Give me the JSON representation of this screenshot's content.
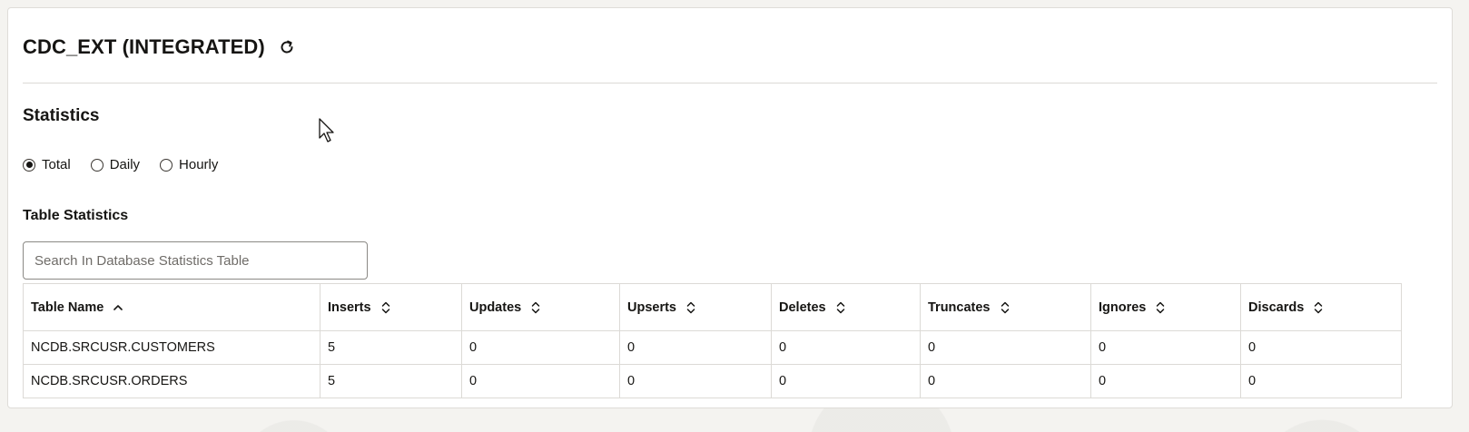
{
  "header": {
    "title": "CDC_EXT (INTEGRATED)",
    "refresh_icon": "refresh-icon"
  },
  "statistics": {
    "title": "Statistics",
    "options": [
      {
        "label": "Total",
        "selected": true
      },
      {
        "label": "Daily",
        "selected": false
      },
      {
        "label": "Hourly",
        "selected": false
      }
    ]
  },
  "table_statistics": {
    "title": "Table Statistics",
    "search": {
      "placeholder": "Search In Database Statistics Table",
      "value": ""
    },
    "columns": [
      {
        "label": "Table Name",
        "sort": "ascending"
      },
      {
        "label": "Inserts",
        "sort": "none"
      },
      {
        "label": "Updates",
        "sort": "none"
      },
      {
        "label": "Upserts",
        "sort": "none"
      },
      {
        "label": "Deletes",
        "sort": "none"
      },
      {
        "label": "Truncates",
        "sort": "none"
      },
      {
        "label": "Ignores",
        "sort": "none"
      },
      {
        "label": "Discards",
        "sort": "none"
      }
    ],
    "rows": [
      [
        "NCDB.SRCUSR.CUSTOMERS",
        "5",
        "0",
        "0",
        "0",
        "0",
        "0",
        "0"
      ],
      [
        "NCDB.SRCUSR.ORDERS",
        "5",
        "0",
        "0",
        "0",
        "0",
        "0",
        "0"
      ]
    ]
  },
  "colors": {
    "text": "#161513",
    "border": "#dcdad6",
    "background": "#ffffff"
  }
}
